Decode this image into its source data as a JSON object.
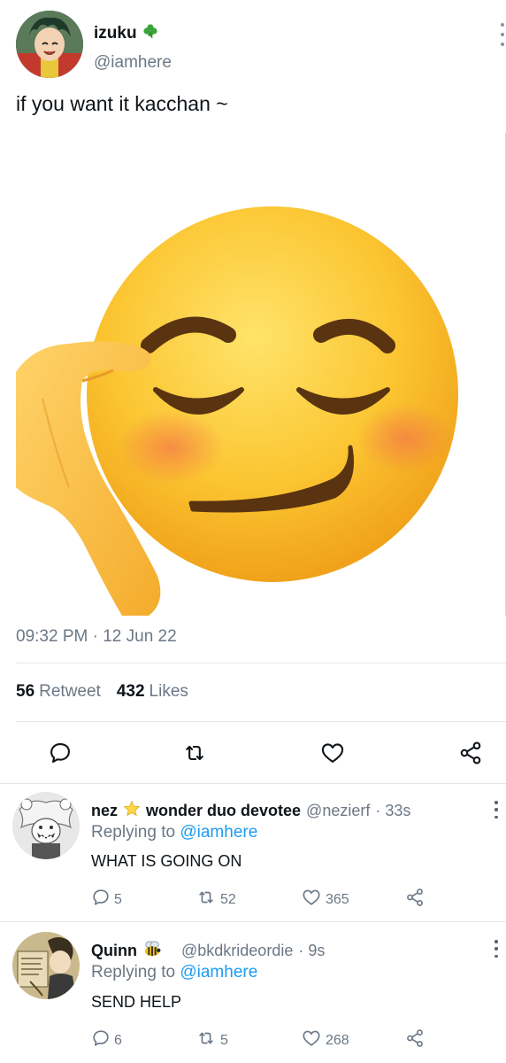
{
  "tweet": {
    "author_name": "izuku",
    "author_badge_icon": "clover-icon",
    "author_handle": "@iamhere",
    "text": "if you want it kacchan ~",
    "media_icon": "smirking-emoji-hand-on-head",
    "timestamp": "09:32 PM · 12 Jun 22",
    "retweet_count": "56",
    "retweet_label": "Retweet",
    "likes_count": "432",
    "likes_label": "Likes"
  },
  "actions": {
    "reply_icon": "reply-icon",
    "retweet_icon": "retweet-icon",
    "like_icon": "heart-icon",
    "share_icon": "share-icon"
  },
  "replies": [
    {
      "name": "nez",
      "badge_icon": "star-icon",
      "name_suffix": "wonder duo devotee",
      "handle": "@nezierf",
      "time": "· 33s",
      "replying_prefix": "Replying to",
      "replying_to": "@iamhere",
      "text": "WHAT IS GOING ON",
      "reply_count": "5",
      "retweet_count": "52",
      "like_count": "365"
    },
    {
      "name": "Quinn",
      "badge_icon": "bee-icon",
      "name_suffix": "",
      "handle": "@bkdkrideordie",
      "time": "· 9s",
      "replying_prefix": "Replying to",
      "replying_to": "@iamhere",
      "text": "SEND HELP",
      "reply_count": "6",
      "retweet_count": "5",
      "like_count": "268"
    }
  ],
  "colors": {
    "link": "#1d9bf0",
    "secondary_text": "#6b7785",
    "primary_text": "#0f1419"
  }
}
